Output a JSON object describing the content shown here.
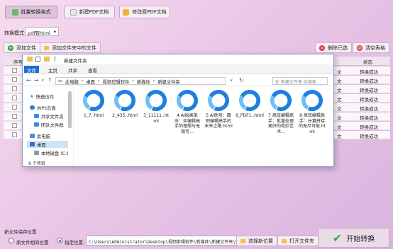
{
  "tabs": {
    "batch_convert": "批量转换格式",
    "new_pdf": "新建PDF文档",
    "edit_pdf": "修改原PDF文档"
  },
  "mode": {
    "label": "转换模式:",
    "value": "pdf转html"
  },
  "toolbar": {
    "add_file": "添加文件",
    "add_folder": "添加文件夹中的文件",
    "delete_selected": "删除已选",
    "clear_list": "清空表格"
  },
  "table": {
    "col_index": "序号",
    "col_status": "状态",
    "row_tag": "文",
    "row_status": "转换成功",
    "rows": 8
  },
  "explorer": {
    "title": "新建文件夹",
    "ribbon": [
      "文件",
      "主页",
      "共享",
      "查看"
    ],
    "breadcrumb": [
      "此电脑",
      "桌面",
      "视频剪辑软件",
      "新媒体",
      "新建文件夹"
    ],
    "search_placeholder": "在 新建文件夹 中搜索",
    "nav": [
      "快速访问",
      "WPS云盘",
      "共享文件夹",
      "团队文件群",
      "此电脑",
      "桌面",
      "本地磁盘 (C:)"
    ],
    "files": [
      "1_7..html",
      "2_435..html",
      "3_11111..html",
      "4 AI绘画革命：如编辑高手的理想与无限可...",
      "5 AI助攻：面吧编辑高手的未来之路.html",
      "6_PDF1..html",
      "7 高效编辑高手：批量处理更好的绝妙艺术...",
      "8 高效编辑高手：长篇拼接的无尽可能.html"
    ],
    "status": "8 个项目"
  },
  "save": {
    "label": "新文件保存位置",
    "opt_same": "原文件相同位置",
    "opt_custom": "指定位置:",
    "path": "C:\\Users\\Administrator\\Desktop\\视频剪辑软件\\新媒体\\新建文件夹\\新建文",
    "choose": "选择新位置",
    "open": "打开文件夹"
  },
  "start": "开始转换",
  "colors": {
    "accent": "#2a7ad6",
    "start_green": "#3aa64a",
    "delete_red": "#d33b3b"
  }
}
